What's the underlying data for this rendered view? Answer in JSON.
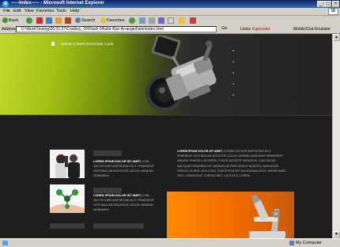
{
  "window": {
    "title": "-----Index----- - Microsoft Internet Explorer",
    "minimize": "_",
    "maximize": "□",
    "close": "×"
  },
  "menu": [
    "File",
    "Edit",
    "View",
    "Favorites",
    "Tools",
    "Help"
  ],
  "toolbar": {
    "back": "Back",
    "search": "Search",
    "favorites": "Favorites"
  },
  "address": {
    "label": "Address",
    "url": "D:\\Work\\Testing\\05.01.07\\Cowboy_09\\Flash 04\\site-Blur-Arranged\\site\\index.html",
    "go": "Go",
    "links": "Links",
    "addon1": "Kapcsolat",
    "addon2": "Mobile2Out Emulator"
  },
  "site": {
    "name": "WWW.COMPANYNAME.COM",
    "items": [
      {
        "lead": "LOREM IPSUM DOLOR SIT AMET,",
        "text": "CON-SECTETUER ADIPISCING ELIT. PRAESENT VESTIBULUM MOLESTIE LACUS. AENEAN NONUMMY."
      },
      {
        "lead": "LOREM IPSUM DOLOR SIT AMET,",
        "text": "CON-SECTETUER ADIPISCING ELIT. PRAESENT VESTIBULUM MOLESTIE LACUS. AENEAN NONUMMY."
      }
    ],
    "article": {
      "lead": "LOREM IPSUM DOLOR SIT AMET,",
      "text": "CONSECTETUER ADIPISCING ELIT. PRAESENT VESTIBULUM MOLESTIE LACUS. AENEAN NONUMMY HENDRERIT MAURIS. PHASELLUS PORTA. FUSCE SUSCIPIT VARIUS MI. CUM SOCIIS NATOQUE PENATIBUS ET MAGNIS DIS PARTURIENT MONTES, NASCETUR RIDICULUS MUS. NULLA DUI. FUSCE FEUGIAT MALESUADA ODIO. MORBI NUNC ODIO, GRAVIDA AT, CURSUS NEC, LUCTUS A, LOREM."
    }
  },
  "status": {
    "text": "",
    "zone": "My Computer"
  }
}
